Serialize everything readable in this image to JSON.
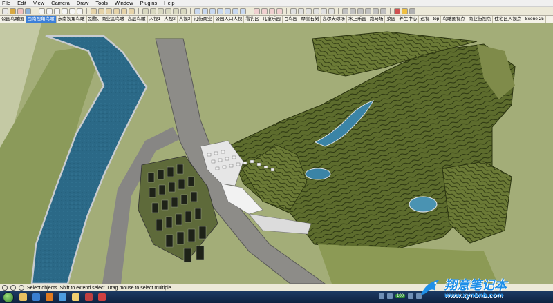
{
  "menu": [
    "File",
    "Edit",
    "View",
    "Camera",
    "Draw",
    "Tools",
    "Window",
    "Plugins",
    "Help"
  ],
  "scene_tabs": [
    "公园鸟瞰图",
    "西南视角鸟瞰",
    "东南视角鸟瞰",
    "别墅、商业区鸟瞰",
    "高层鸟瞰",
    "人视1",
    "人视2",
    "人视3",
    "沿街商业",
    "公园入口人视",
    "看钓区",
    "儿童乐园",
    "百鸟园",
    "摩崖石刻",
    "高尔夫球场",
    "水上乐园",
    "跑马场",
    "菜园",
    "养生中心",
    "远视",
    "top",
    "鸟瞰图视点",
    "商业街视点",
    "住宅区入视点",
    "Scene 25"
  ],
  "active_scene_index": 1,
  "status": {
    "message": "Select objects. Shift to extend select. Drag mouse to select multiple."
  },
  "tray": {
    "badge": "100"
  },
  "watermark": {
    "name": "翔意笔记本",
    "url": "www.xynbnb.com"
  },
  "colors": {
    "terrain": "#5b6a2c",
    "ground": "#99a370",
    "river": "#2d6f8c",
    "road": "#8c8c8c",
    "accent": "#3b7fd9"
  }
}
